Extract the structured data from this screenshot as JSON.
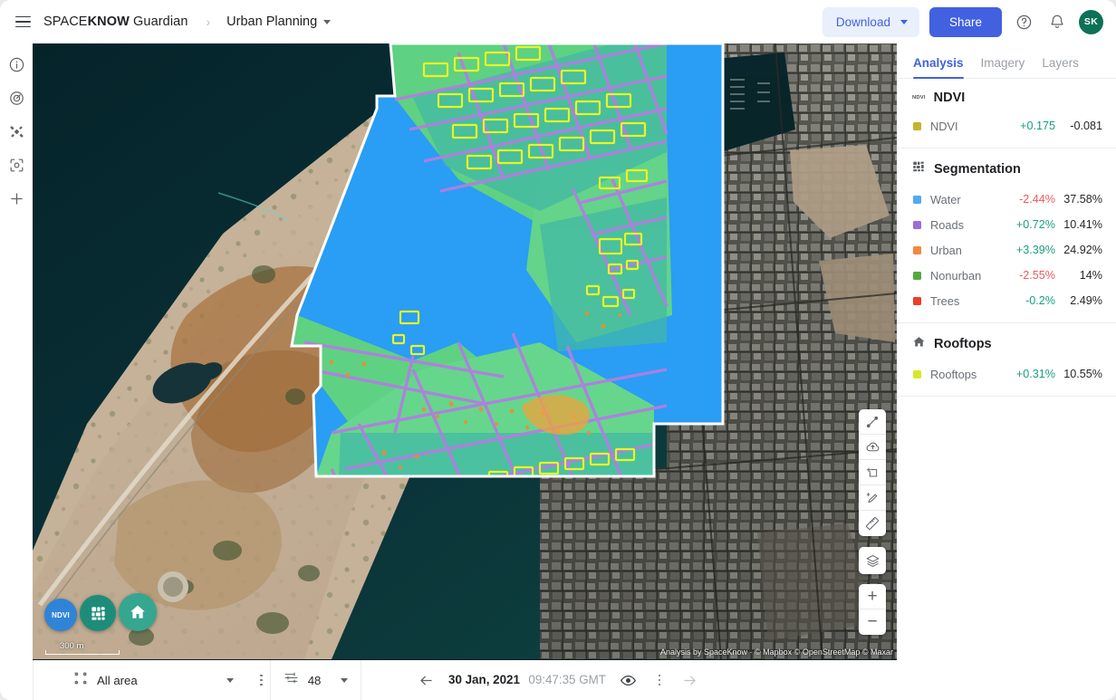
{
  "topbar": {
    "menu_icon": "hamburger-icon",
    "brand_prefix": "SPACE",
    "brand_bold": "KNOW",
    "brand_suffix": " Guardian",
    "breadcrumb_sep": "›",
    "project": "Urban Planning",
    "download_label": "Download",
    "share_label": "Share",
    "help_icon": "help-circle-icon",
    "bell_icon": "bell-icon",
    "avatar_initials": "SK"
  },
  "rail": {
    "items": [
      {
        "name": "info-icon",
        "label": "Info"
      },
      {
        "name": "target-icon",
        "label": "Target"
      },
      {
        "name": "satellite-icon",
        "label": "Satellite"
      },
      {
        "name": "scan-frame-icon",
        "label": "Scan area"
      },
      {
        "name": "plus-icon",
        "label": "Add"
      }
    ]
  },
  "map": {
    "tools": [
      {
        "name": "polyline-icon",
        "label": "Draw line"
      },
      {
        "name": "cloud-upload-icon",
        "label": "Upload"
      },
      {
        "name": "add-rectangle-icon",
        "label": "Add rectangle"
      },
      {
        "name": "add-pencil-icon",
        "label": "Draw shape"
      },
      {
        "name": "ruler-icon",
        "label": "Measure"
      }
    ],
    "layers_label": "Layers",
    "zoom_in": "+",
    "zoom_out": "−",
    "fabs": [
      {
        "name": "ndvi-fab",
        "label": "NDVI",
        "color": "#2f84d8"
      },
      {
        "name": "segmentation-fab",
        "label": "Segmentation",
        "color": "#1d8d7a"
      },
      {
        "name": "rooftops-fab",
        "label": "Rooftops",
        "color": "#35a690"
      }
    ],
    "scale_label": "300 m",
    "attribution": "Analysis by SpaceKnow · © Mapbox © OpenStreetMap © Maxar"
  },
  "panel": {
    "tabs": [
      {
        "label": "Analysis",
        "active": true
      },
      {
        "label": "Imagery",
        "active": false
      },
      {
        "label": "Layers",
        "active": false
      }
    ],
    "sections": [
      {
        "id": "ndvi",
        "icon": "ndvi-badge-icon",
        "icon_text": "NDVI",
        "title": "NDVI",
        "rows": [
          {
            "label": "NDVI",
            "color": "#c4b42e",
            "delta": "+0.175",
            "delta_dir": "up",
            "value": "-0.081"
          }
        ]
      },
      {
        "id": "segmentation",
        "icon": "segmentation-grid-icon",
        "title": "Segmentation",
        "rows": [
          {
            "label": "Water",
            "color": "#53a9f0",
            "delta": "-2.44%",
            "delta_dir": "down",
            "value": "37.58%"
          },
          {
            "label": "Roads",
            "color": "#9b6fd6",
            "delta": "+0.72%",
            "delta_dir": "up",
            "value": "10.41%"
          },
          {
            "label": "Urban",
            "color": "#f2883c",
            "delta": "+3.39%",
            "delta_dir": "up",
            "value": "24.92%"
          },
          {
            "label": "Nonurban",
            "color": "#56a83f",
            "delta": "-2.55%",
            "delta_dir": "down",
            "value": "14%"
          },
          {
            "label": "Trees",
            "color": "#ef3d26",
            "delta": "-0.2%",
            "delta_dir": "up",
            "value": "2.49%"
          }
        ]
      },
      {
        "id": "rooftops",
        "icon": "home-icon",
        "title": "Rooftops",
        "rows": [
          {
            "label": "Rooftops",
            "color": "#d7e825",
            "delta": "+0.31%",
            "delta_dir": "up",
            "value": "10.55%"
          }
        ]
      }
    ]
  },
  "bottombar": {
    "aoi_icon": "aoi-frame-icon",
    "aoi_label": "All area",
    "filter_icon": "sliders-icon",
    "scene_count": "48",
    "prev_icon": "arrow-left-icon",
    "next_icon": "arrow-right-icon",
    "date": "30 Jan, 2021",
    "time": "09:47:35 GMT",
    "eye_icon": "eye-icon",
    "more_icon": "kebab-icon"
  },
  "colors": {
    "accent": "#4161e0",
    "accent_soft": "#eaeffc",
    "up": "#17a07e",
    "down": "#ea5b5b",
    "avatar": "#0c7157"
  }
}
